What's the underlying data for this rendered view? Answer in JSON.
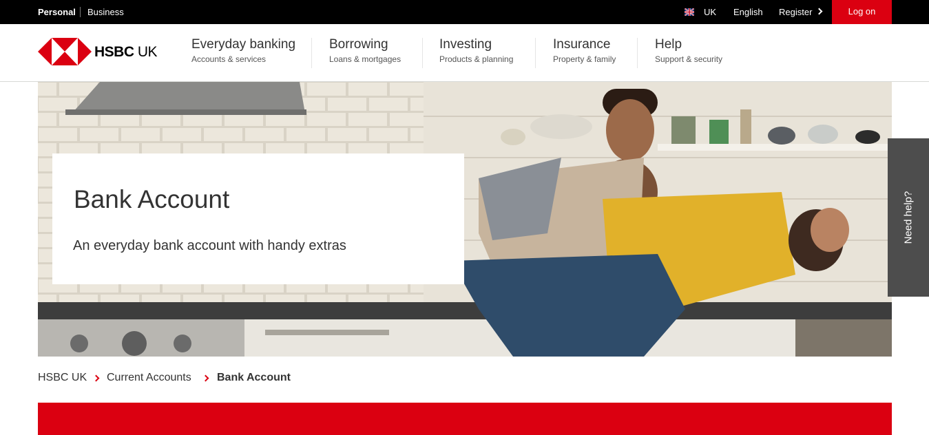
{
  "topbar": {
    "personal": "Personal",
    "business": "Business",
    "region": "UK",
    "language": "English",
    "register": "Register",
    "logon": "Log on"
  },
  "header": {
    "logo_brand": "HSBC",
    "logo_suffix": "UK",
    "nav": [
      {
        "title": "Everyday banking",
        "subtitle": "Accounts & services"
      },
      {
        "title": "Borrowing",
        "subtitle": "Loans & mortgages"
      },
      {
        "title": "Investing",
        "subtitle": "Products & planning"
      },
      {
        "title": "Insurance",
        "subtitle": "Property & family"
      },
      {
        "title": "Help",
        "subtitle": "Support & security"
      }
    ]
  },
  "hero": {
    "title": "Bank Account",
    "subtitle": "An everyday bank account with handy extras"
  },
  "need_help": "Need help?",
  "breadcrumb": [
    {
      "label": "HSBC UK"
    },
    {
      "label": "Current Accounts"
    },
    {
      "label": "Bank Account"
    }
  ],
  "colors": {
    "brand_red": "#db0011",
    "topbar_bg": "#000000",
    "help_tab": "#4d4d4d"
  }
}
